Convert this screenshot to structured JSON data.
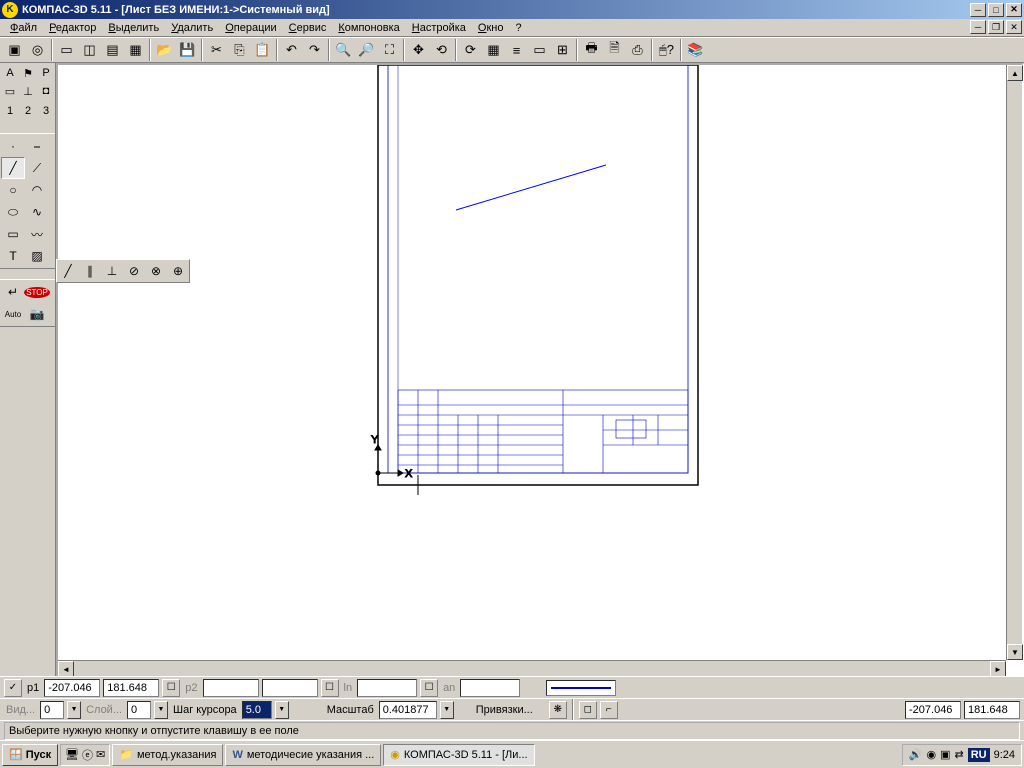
{
  "title": "КОМПАС-3D 5.11 - [Лист БЕЗ ИМЕНИ:1->Системный вид]",
  "menu": [
    "Файл",
    "Редактор",
    "Выделить",
    "Удалить",
    "Операции",
    "Сервис",
    "Компоновка",
    "Настройка",
    "Окно",
    "?"
  ],
  "params": {
    "p1_label": "p1",
    "p1_x": "-207.046",
    "p1_y": "181.648",
    "p2_label": "p2",
    "ln_label": "ln",
    "an_label": "an"
  },
  "row2": {
    "vid_label": "Вид...",
    "vid_val": "0",
    "layer_label": "Слой...",
    "layer_val": "0",
    "step_label": "Шаг курсора",
    "step_val": "5.0",
    "scale_label": "Масштаб",
    "scale_val": "0.401877",
    "snap_label": "Привязки...",
    "coord_x": "-207.046",
    "coord_y": "181.648"
  },
  "status": "Выберите нужную кнопку и отпустите клавишу в ее поле",
  "taskbar": {
    "start": "Пуск",
    "folder": "метод.указания",
    "word": "методичесие указания ...",
    "app": "КОМПАС-3D 5.11 - [Ли...",
    "lang": "RU",
    "time": "9:24"
  },
  "tabs": [
    "1",
    "2",
    "3"
  ]
}
